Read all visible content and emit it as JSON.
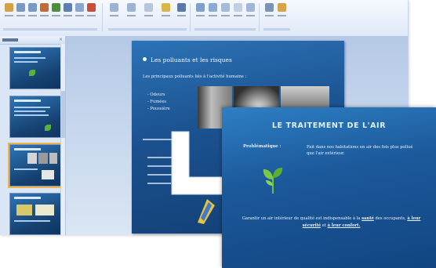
{
  "app": {
    "ribbon_groups": 6
  },
  "thumbnails": [
    {
      "number": "",
      "selected": false
    },
    {
      "number": "",
      "selected": false
    },
    {
      "number": "",
      "selected": true
    },
    {
      "number": "",
      "selected": false
    }
  ],
  "main_slide": {
    "title": "Les polluants et les risques",
    "subtitle": "Les principaux polluants liés à l'activité humaine :",
    "bullets": [
      "- Odeurs",
      "- Fumées",
      "- Poussière"
    ]
  },
  "second_slide": {
    "title": "LE TRAITEMENT DE L'AIR",
    "label": "Problématique :",
    "problem_text": "Fait dans nos habitations un air des fois plus pollué que l'air extérieur.",
    "conclusion_pre": "Garantir un air intérieur de qualité  est indispensable à la",
    "conclusion_u1": "santé",
    "conclusion_mid": " des occupants, ",
    "conclusion_u2": "à leur sécurité",
    "conclusion_and": " et ",
    "conclusion_u3": "à leur confort."
  },
  "colors": {
    "slide_blue": "#1b518f",
    "leaf_green": "#58b23c",
    "selection": "#f0b44a"
  },
  "icons": [
    "leaf-icon",
    "arrow-icon"
  ]
}
